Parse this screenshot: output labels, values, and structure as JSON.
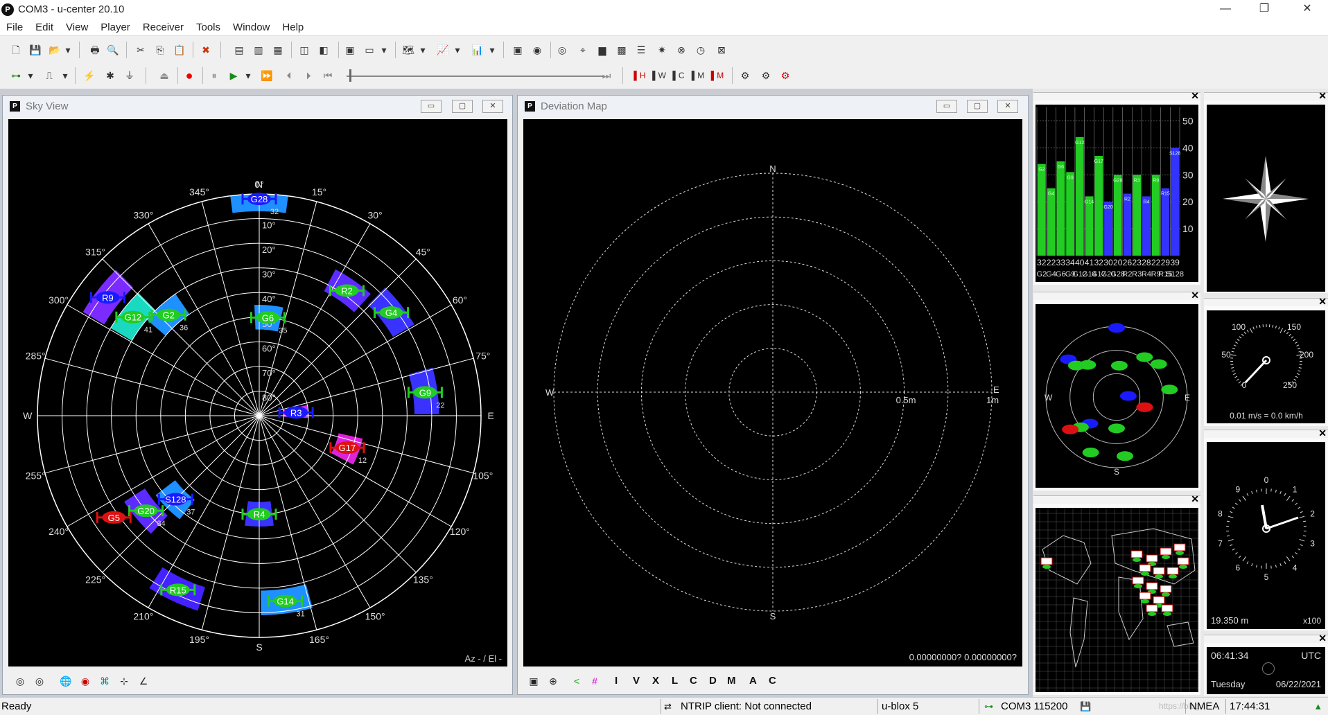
{
  "app": {
    "title": "COM3 - u-center 20.10",
    "logo_letter": "P",
    "window_controls": [
      "minimize-icon",
      "restore-icon",
      "close-icon"
    ]
  },
  "menu": [
    "File",
    "Edit",
    "View",
    "Player",
    "Receiver",
    "Tools",
    "Window",
    "Help"
  ],
  "toolbar2": {
    "letter_buttons": [
      "H",
      "W",
      "C",
      "M",
      "M"
    ]
  },
  "sky_view": {
    "title": "Sky View",
    "footer_label": "Az - / El -",
    "compass": {
      "N": "N",
      "E": "E",
      "S": "S",
      "W": "W"
    },
    "azimuth_labels": [
      "0°",
      "15°",
      "30°",
      "45°",
      "60°",
      "75°",
      "105°",
      "120°",
      "135°",
      "150°",
      "165°",
      "195°",
      "210°",
      "225°",
      "240°",
      "255°",
      "285°",
      "300°",
      "315°",
      "330°",
      "345°"
    ],
    "elevation_labels": [
      "10°",
      "20°",
      "30°",
      "40°",
      "50°",
      "60°",
      "70°",
      "80°"
    ],
    "satellites": [
      {
        "id": "G28",
        "az": 0,
        "el": 2,
        "color": "#1a1aff",
        "cn0": "32",
        "cell": "#1e90ff"
      },
      {
        "id": "R2",
        "az": 35,
        "el": 28,
        "color": "#22cc22",
        "cn0": "",
        "cell": "#5b2bff"
      },
      {
        "id": "G4",
        "az": 52,
        "el": 22,
        "color": "#22cc22",
        "cn0": "",
        "cell": "#3a32ff"
      },
      {
        "id": "G6",
        "az": 5,
        "el": 50,
        "color": "#22cc22",
        "cn0": "35",
        "cell": "#1e90ff"
      },
      {
        "id": "R9",
        "az": 308,
        "el": 12,
        "color": "#1a1aff",
        "cn0": "",
        "cell": "#7b2bff"
      },
      {
        "id": "G12",
        "az": 308,
        "el": 25,
        "color": "#22cc22",
        "cn0": "41",
        "cell": "#19d9c0"
      },
      {
        "id": "G2",
        "az": 318,
        "el": 35,
        "color": "#22cc22",
        "cn0": "36",
        "cell": "#1e90ff"
      },
      {
        "id": "G9",
        "az": 82,
        "el": 22,
        "color": "#22cc22",
        "cn0": "22",
        "cell": "#3a32ff"
      },
      {
        "id": "R3",
        "az": 85,
        "el": 75,
        "color": "#1a1aff",
        "cn0": "",
        "cell": "#cc33ff"
      },
      {
        "id": "G17",
        "az": 110,
        "el": 52,
        "color": "#dd1111",
        "cn0": "12",
        "cell": "#dd22dd"
      },
      {
        "id": "S128",
        "az": 225,
        "el": 42,
        "color": "#1a1aff",
        "cn0": "37",
        "cell": "#1e90ff"
      },
      {
        "id": "G20",
        "az": 230,
        "el": 30,
        "color": "#22cc22",
        "cn0": "34",
        "cell": "#5b2bff"
      },
      {
        "id": "G5",
        "az": 235,
        "el": 18,
        "color": "#dd1111",
        "cn0": "",
        "cell": ""
      },
      {
        "id": "R4",
        "az": 180,
        "el": 50,
        "color": "#22cc22",
        "cn0": "",
        "cell": "#3a32ff"
      },
      {
        "id": "R15",
        "az": 205,
        "el": 12,
        "color": "#22cc22",
        "cn0": "",
        "cell": "#4422ff"
      },
      {
        "id": "G14",
        "az": 172,
        "el": 14,
        "color": "#22cc22",
        "cn0": "31",
        "cell": "#1e90ff"
      }
    ]
  },
  "deviation_map": {
    "title": "Deviation Map",
    "compass": {
      "N": "N",
      "E": "E",
      "S": "S",
      "W": "W"
    },
    "ring_labels": [
      "0.5m",
      "1m"
    ],
    "readout": "0.00000000? 0.00000000?",
    "letter_buttons": [
      "I",
      "V",
      "X",
      "L",
      "C",
      "D",
      "M",
      "A",
      "C"
    ]
  },
  "signal_panel": {
    "y_ticks": [
      "50",
      "40",
      "30",
      "20",
      "10"
    ],
    "bars": [
      {
        "label": "G2",
        "value": 24,
        "color": "#22cc22",
        "cn0": "32"
      },
      {
        "label": "G4",
        "value": 15,
        "color": "#22cc22",
        "cn0": "22"
      },
      {
        "label": "G6",
        "value": 25,
        "color": "#22cc22",
        "cn0": "33"
      },
      {
        "label": "G9",
        "value": 21,
        "color": "#22cc22",
        "cn0": "34"
      },
      {
        "label": "G12",
        "value": 34,
        "color": "#22cc22",
        "cn0": "40"
      },
      {
        "label": "G14",
        "value": 12,
        "color": "#22cc22",
        "cn0": "41"
      },
      {
        "label": "G17",
        "value": 27,
        "color": "#22cc22",
        "cn0": "32"
      },
      {
        "label": "G20",
        "value": 10,
        "color": "#3333ff",
        "cn0": "30"
      },
      {
        "label": "G28",
        "value": 20,
        "color": "#22cc22",
        "cn0": "20"
      },
      {
        "label": "R2",
        "value": 13,
        "color": "#3333ff",
        "cn0": "26"
      },
      {
        "label": "R3",
        "value": 20,
        "color": "#22cc22",
        "cn0": "23"
      },
      {
        "label": "R4",
        "value": 12,
        "color": "#3333ff",
        "cn0": "28"
      },
      {
        "label": "R9",
        "value": 20,
        "color": "#22cc22",
        "cn0": "22"
      },
      {
        "label": "R15",
        "value": 15,
        "color": "#3333ff",
        "cn0": "29"
      },
      {
        "label": "S128",
        "value": 30,
        "color": "#3333ff",
        "cn0": "39"
      }
    ]
  },
  "mini_sky": {
    "E": "E",
    "W": "W",
    "S": "S"
  },
  "speedometer": {
    "labels": [
      "100",
      "150",
      "50",
      "200",
      "0",
      "250"
    ],
    "readout": "0.01 m/s = 0.0 km/h"
  },
  "altimeter": {
    "labels": [
      "0",
      "1",
      "2",
      "3",
      "4",
      "5",
      "6",
      "7",
      "8",
      "9"
    ],
    "readout": "19.350 m",
    "scale": "x100"
  },
  "clock": {
    "time": "06:41:34",
    "zone": "UTC",
    "day": "Tuesday",
    "date": "06/22/2021"
  },
  "status": {
    "ready": "Ready",
    "ntrip": "NTRIP client: Not connected",
    "receiver": "u-blox 5",
    "port": "COM3 115200",
    "protocol": "NMEA",
    "time": "17:44:31",
    "watermark": "https://blog.csdn.net/weixin_43..."
  }
}
